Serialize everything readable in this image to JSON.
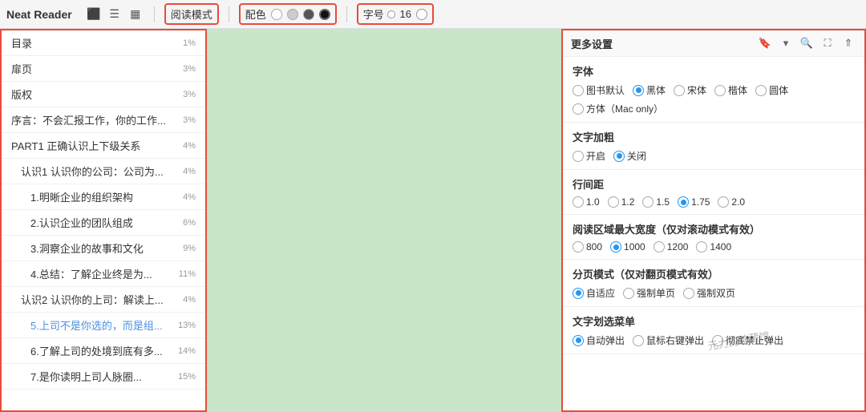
{
  "app": {
    "title": "Neat Reader"
  },
  "toolbar": {
    "reading_mode_label": "阅读模式",
    "color_label": "配色",
    "font_size_label": "字号",
    "font_size_value": "16",
    "colors": [
      {
        "name": "white",
        "class": "white"
      },
      {
        "name": "gray",
        "class": "gray"
      },
      {
        "name": "dark",
        "class": "dark"
      },
      {
        "name": "black",
        "class": "black"
      }
    ]
  },
  "toc": {
    "title": "目录",
    "items": [
      {
        "text": "目录",
        "percent": "1%",
        "indent": 0,
        "active": false
      },
      {
        "text": "扉页",
        "percent": "3%",
        "indent": 0,
        "active": false
      },
      {
        "text": "版权",
        "percent": "3%",
        "indent": 0,
        "active": false
      },
      {
        "text": "序言：不会汇报工作，你的工作...",
        "percent": "3%",
        "indent": 0,
        "active": false
      },
      {
        "text": "PART1 正确认识上下级关系",
        "percent": "4%",
        "indent": 0,
        "active": false
      },
      {
        "text": "认识1 认识你的公司：公司为...",
        "percent": "4%",
        "indent": 1,
        "active": false
      },
      {
        "text": "1.明晰企业的组织架构",
        "percent": "4%",
        "indent": 2,
        "active": false
      },
      {
        "text": "2.认识企业的团队组成",
        "percent": "6%",
        "indent": 2,
        "active": false
      },
      {
        "text": "3.洞察企业的故事和文化",
        "percent": "9%",
        "indent": 2,
        "active": false
      },
      {
        "text": "4.总结：了解企业终是为...",
        "percent": "11%",
        "indent": 2,
        "active": false
      },
      {
        "text": "认识2 认识你的上司：解读上...",
        "percent": "4%",
        "indent": 1,
        "active": false
      },
      {
        "text": "5.上司不是你选的，而是组...",
        "percent": "13%",
        "indent": 2,
        "active": true
      },
      {
        "text": "6.了解上司的处境到底有多...",
        "percent": "14%",
        "indent": 2,
        "active": false
      },
      {
        "text": "7.是你读明上司人脉圈...",
        "percent": "15%",
        "indent": 2,
        "active": false
      }
    ]
  },
  "settings": {
    "header_title": "更多设置",
    "sections": [
      {
        "title": "字体",
        "options": [
          {
            "label": "图书默认",
            "checked": false
          },
          {
            "label": "黑体",
            "checked": true
          },
          {
            "label": "宋体",
            "checked": false
          },
          {
            "label": "楷体",
            "checked": false
          },
          {
            "label": "圆体",
            "checked": false
          },
          {
            "label": "方体（Mac only）",
            "checked": false
          }
        ]
      },
      {
        "title": "文字加粗",
        "options": [
          {
            "label": "开启",
            "checked": false
          },
          {
            "label": "关闭",
            "checked": true
          }
        ]
      },
      {
        "title": "行间距",
        "options": [
          {
            "label": "1.0",
            "checked": false
          },
          {
            "label": "1.2",
            "checked": false
          },
          {
            "label": "1.5",
            "checked": false
          },
          {
            "label": "1.75",
            "checked": true
          },
          {
            "label": "2.0",
            "checked": false
          }
        ]
      },
      {
        "title": "阅读区域最大宽度（仅对滚动模式有效）",
        "options": [
          {
            "label": "800",
            "checked": false
          },
          {
            "label": "1000",
            "checked": true
          },
          {
            "label": "1200",
            "checked": false
          },
          {
            "label": "1400",
            "checked": false
          }
        ]
      },
      {
        "title": "分页模式（仅对翻页模式有效）",
        "options": [
          {
            "label": "自适应",
            "checked": true
          },
          {
            "label": "强制单页",
            "checked": false
          },
          {
            "label": "强制双页",
            "checked": false
          }
        ]
      },
      {
        "title": "文字划选菜单",
        "options": [
          {
            "label": "自动弹出",
            "checked": true
          },
          {
            "label": "鼠标右键弹出",
            "checked": false
          },
          {
            "label": "彻底禁止弹出",
            "checked": false
          }
        ]
      }
    ]
  },
  "watermark": "元力的珍藏馆"
}
